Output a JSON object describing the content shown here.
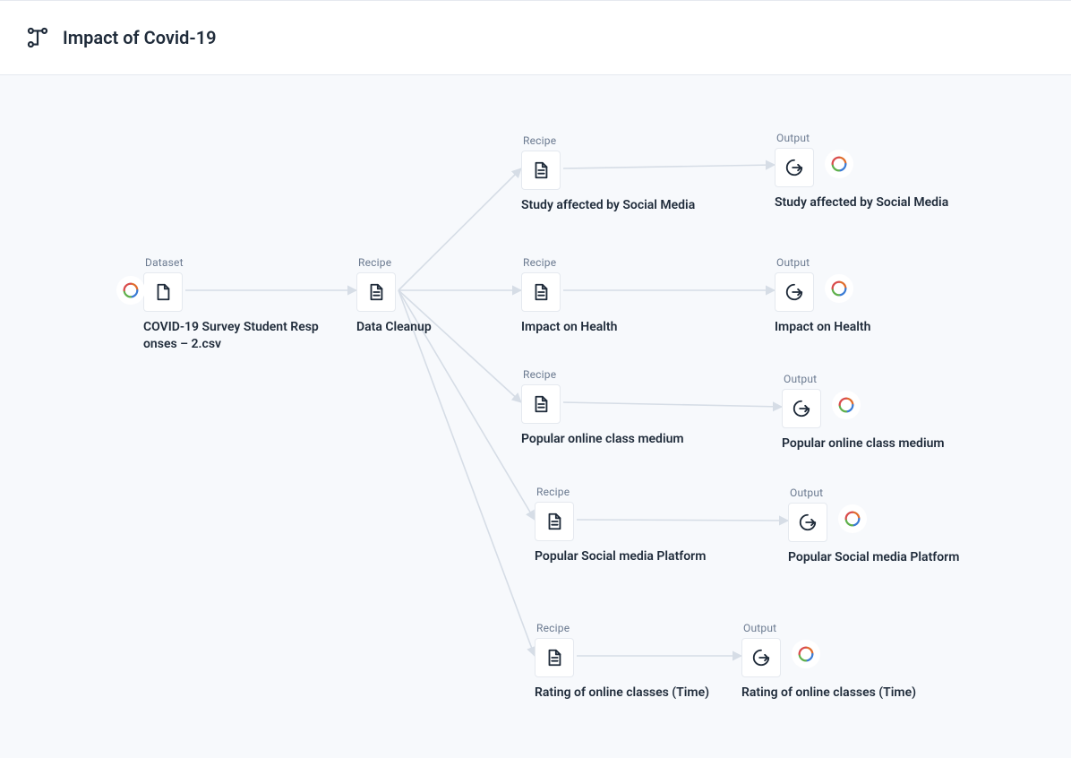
{
  "header": {
    "title": "Impact of Covid-19"
  },
  "labels": {
    "dataset": "Dataset",
    "recipe": "Recipe",
    "output": "Output"
  },
  "nodes": {
    "dataset": {
      "title": "COVID-19 Survey Student Resp onses – 2.csv"
    },
    "dataCleanup": {
      "title": "Data Cleanup"
    },
    "r1": {
      "title": "Study affected by Social Media"
    },
    "r2": {
      "title": "Impact on Health"
    },
    "r3": {
      "title": "Popular  online class  medium"
    },
    "r4": {
      "title": "Popular Social media Platform"
    },
    "r5": {
      "title": "Rating of online classes (Time)"
    },
    "o1": {
      "title": "Study affected by Social Media"
    },
    "o2": {
      "title": "Impact on Health"
    },
    "o3": {
      "title": "Popular  online class  medium"
    },
    "o4": {
      "title": "Popular Social media Platform"
    },
    "o5": {
      "title": "Rating of online classes (Time)"
    }
  }
}
